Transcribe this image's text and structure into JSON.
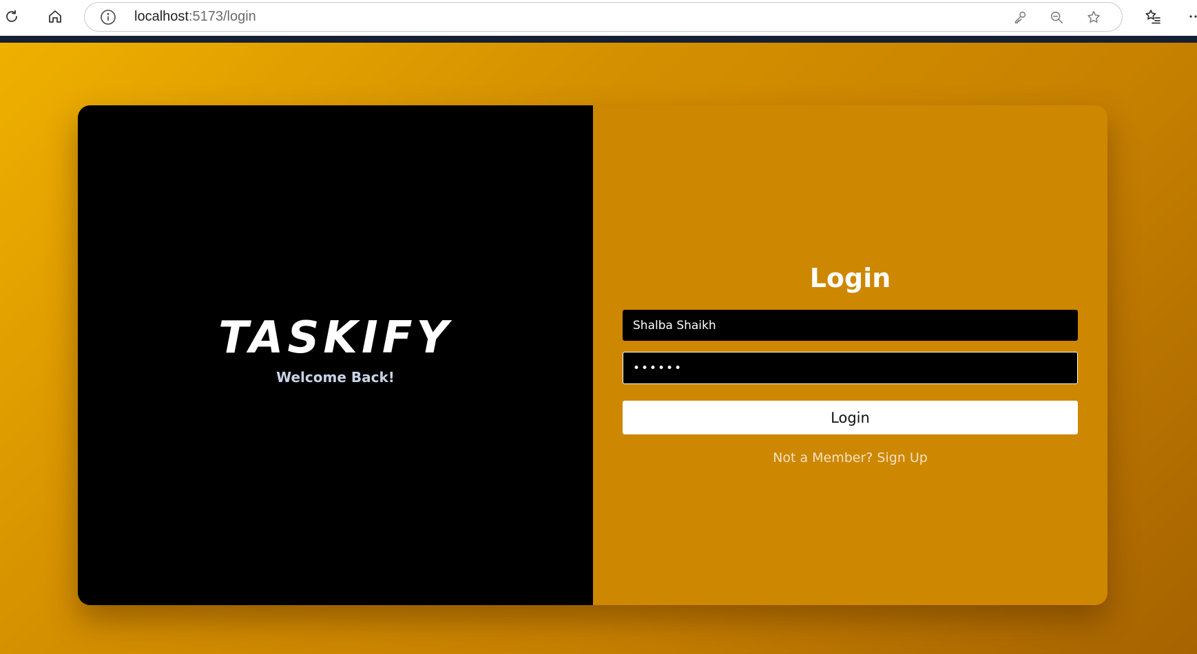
{
  "browser": {
    "url_host": "localhost",
    "url_path": ":5173/login",
    "icons": [
      "refresh-icon",
      "home-icon",
      "site-info-icon",
      "password-key-icon",
      "zoom-out-icon",
      "favorite-star-icon",
      "favorites-list-icon",
      "more-menu-icon"
    ]
  },
  "brand": {
    "name": "TASKIFY",
    "tagline": "Welcome Back!"
  },
  "login": {
    "title": "Login",
    "username_value": "Shalba Shaikh",
    "password_value": "••••••",
    "button_label": "Login",
    "signup_text": "Not a Member? Sign Up"
  },
  "colors": {
    "background_start": "#efb000",
    "background_end": "#a66300",
    "left_panel": "#000000",
    "right_panel": "#cd8700",
    "button_bg": "#ffffff",
    "input_bg": "#000000"
  }
}
